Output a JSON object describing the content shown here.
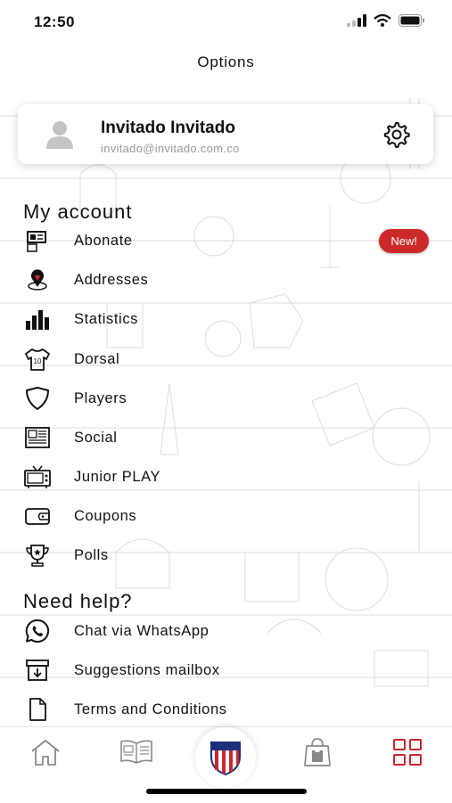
{
  "status_bar": {
    "time": "12:50"
  },
  "header": {
    "title": "Options"
  },
  "profile": {
    "name": "Invitado Invitado",
    "email": "invitado@invitado.com.co"
  },
  "sections": {
    "my_account": "My account",
    "need_help": "Need help?"
  },
  "my_account_items": [
    {
      "label": "Abonate",
      "icon": "season-ticket-icon",
      "badge": "New!"
    },
    {
      "label": "Addresses",
      "icon": "location-pin-icon"
    },
    {
      "label": "Statistics",
      "icon": "bar-chart-icon"
    },
    {
      "label": "Dorsal",
      "icon": "jersey-icon"
    },
    {
      "label": "Players",
      "icon": "shield-icon"
    },
    {
      "label": "Social",
      "icon": "newspaper-icon"
    },
    {
      "label": "Junior PLAY",
      "icon": "tv-icon"
    },
    {
      "label": "Coupons",
      "icon": "wallet-icon"
    },
    {
      "label": "Polls",
      "icon": "trophy-icon"
    }
  ],
  "help_items": [
    {
      "label": "Chat via WhatsApp",
      "icon": "whatsapp-icon"
    },
    {
      "label": "Suggestions mailbox",
      "icon": "mailbox-icon"
    },
    {
      "label": "Terms and Conditions",
      "icon": "document-icon"
    }
  ],
  "tabbar": {
    "items": [
      "home-icon",
      "news-icon",
      "club-crest-icon",
      "shop-icon",
      "grid-menu-icon"
    ],
    "active_color": "#c8282d"
  },
  "colors": {
    "accent": "#c8282d",
    "badge": "#cc2a2a"
  }
}
